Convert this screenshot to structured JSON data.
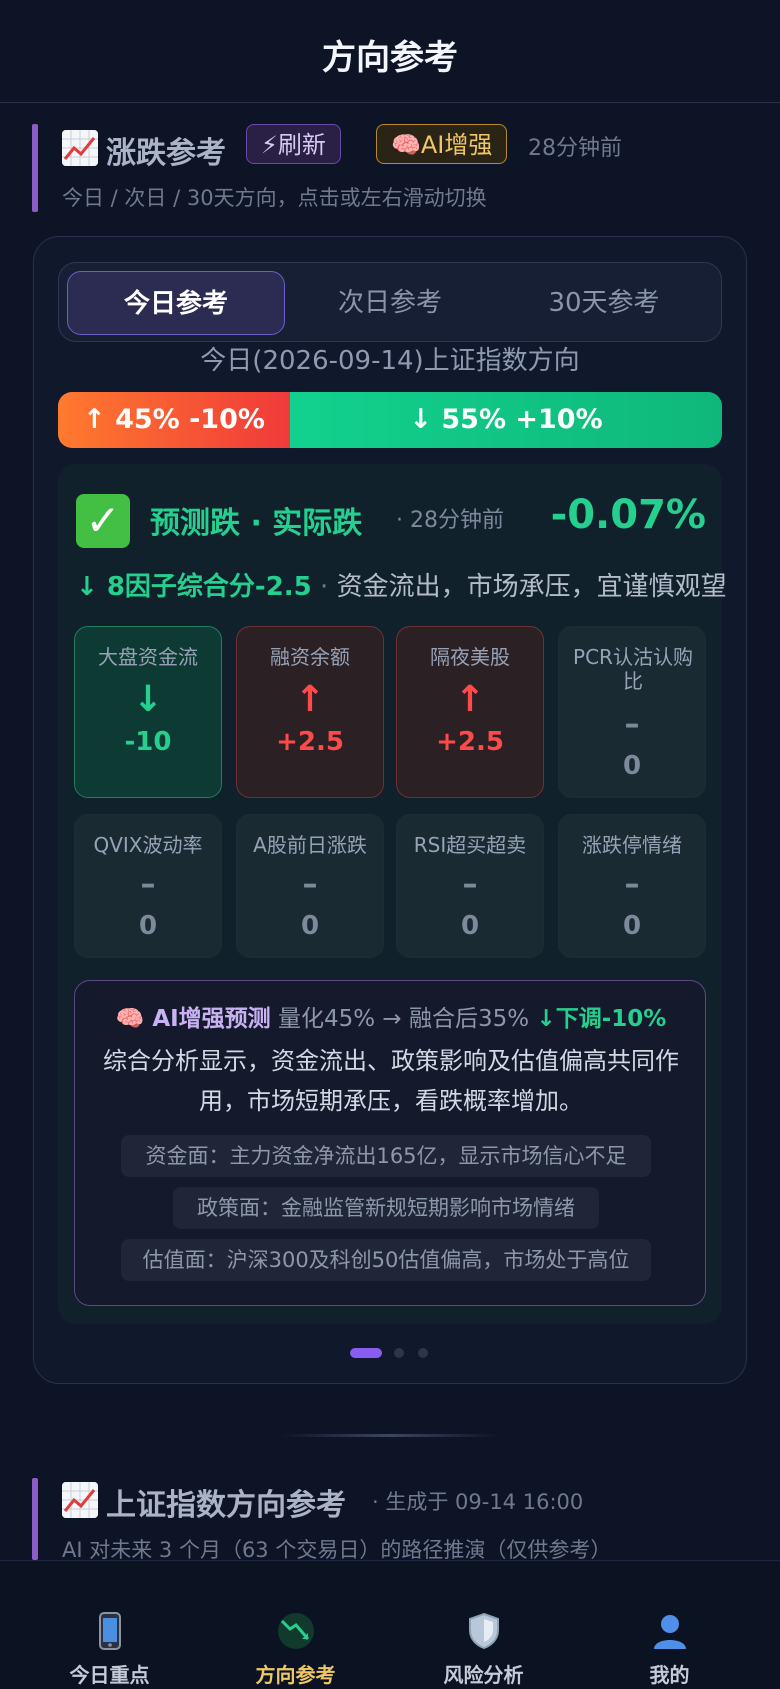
{
  "header": {
    "title": "方向参考"
  },
  "section1": {
    "title": "涨跌参考",
    "refresh_label": "⚡刷新",
    "ai_label": "🧠AI增强",
    "time": "28分钟前",
    "subtitle": "今日 / 次日 / 30天方向，点击或左右滑动切换"
  },
  "tabs": [
    {
      "label": "今日参考",
      "active": true
    },
    {
      "label": "次日参考",
      "active": false
    },
    {
      "label": "30天参考",
      "active": false
    }
  ],
  "direction_title": "今日(2026-09-14)上证指数方向",
  "split": {
    "up_label": "↑ 45% -10%",
    "down_label": "↓ 55% +10%",
    "up_fraction": 0.35,
    "up_color": "#f03a3a",
    "down_color": "#12d18e"
  },
  "result": {
    "prediction": "预测跌 · 实际跌",
    "time": "· 28分钟前",
    "change": "-0.07%",
    "factor_score": "↓ 8因子综合分-2.5",
    "factor_sep": " · ",
    "factor_text": "资金流出，市场承压，宜谨慎观望"
  },
  "factors": [
    {
      "label": "大盘资金流",
      "arrow": "↓",
      "value": "-10",
      "tone": "green"
    },
    {
      "label": "融资余额",
      "arrow": "↑",
      "value": "+2.5",
      "tone": "red"
    },
    {
      "label": "隔夜美股",
      "arrow": "↑",
      "value": "+2.5",
      "tone": "red"
    },
    {
      "label": "PCR认沽认购比",
      "arrow": "–",
      "value": "0",
      "tone": "gray"
    },
    {
      "label": "QVIX波动率",
      "arrow": "–",
      "value": "0",
      "tone": "gray"
    },
    {
      "label": "A股前日涨跌",
      "arrow": "–",
      "value": "0",
      "tone": "gray"
    },
    {
      "label": "RSI超买超卖",
      "arrow": "–",
      "value": "0",
      "tone": "gray"
    },
    {
      "label": "涨跌停情绪",
      "arrow": "–",
      "value": "0",
      "tone": "gray"
    }
  ],
  "ai": {
    "title": "🧠 AI增强预测",
    "quant": " 量化45% → 融合后35% ",
    "adjust": "↓下调-10%",
    "summary": "综合分析显示，资金流出、政策影响及估值偏高共同作用，市场短期承压，看跌概率增加。",
    "points": [
      "资金面：主力资金净流出165亿，显示市场信心不足",
      "政策面：金融监管新规短期影响市场情绪",
      "估值面：沪深300及科创50估值偏高，市场处于高位"
    ]
  },
  "pager": {
    "count": 3,
    "active": 0
  },
  "section2": {
    "title": "上证指数方向参考",
    "generated": "· 生成于 09-14 16:00",
    "subtitle": "AI 对未来 3 个月（63 个交易日）的路径推演（仅供参考）"
  },
  "nav": [
    {
      "label": "今日重点",
      "icon": "phone-icon",
      "active": false
    },
    {
      "label": "方向参考",
      "icon": "chart-down-icon",
      "active": true
    },
    {
      "label": "风险分析",
      "icon": "shield-icon",
      "active": false
    },
    {
      "label": "我的",
      "icon": "user-icon",
      "active": false
    }
  ]
}
